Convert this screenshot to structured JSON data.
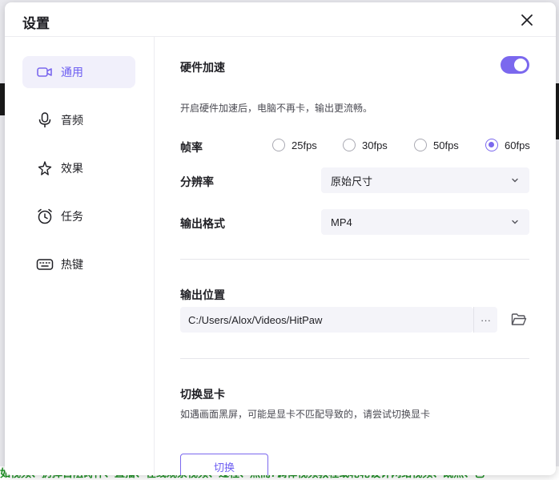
{
  "dialog": {
    "title": "设置"
  },
  "sidebar": {
    "items": [
      {
        "label": "通用",
        "icon": "video-camera-icon",
        "active": true
      },
      {
        "label": "音频",
        "icon": "microphone-icon",
        "active": false
      },
      {
        "label": "效果",
        "icon": "sparkle-icon",
        "active": false
      },
      {
        "label": "任务",
        "icon": "alarm-clock-icon",
        "active": false
      },
      {
        "label": "热键",
        "icon": "keyboard-icon",
        "active": false
      }
    ]
  },
  "general": {
    "hw_accel": {
      "title": "硬件加速",
      "enabled": true,
      "description": "开启硬件加速后，电脑不再卡，输出更流畅。"
    },
    "framerate": {
      "title": "帧率",
      "options": [
        "25fps",
        "30fps",
        "50fps",
        "60fps"
      ],
      "selected": "60fps"
    },
    "resolution": {
      "title": "分辨率",
      "value": "原始尺寸"
    },
    "format": {
      "title": "输出格式",
      "value": "MP4"
    },
    "output": {
      "title": "输出位置",
      "path": "C:/Users/Alox/Videos/HitPaw",
      "more_label": "···"
    },
    "gpu": {
      "title": "切换显卡",
      "description": "如遇画面黑屏，可能是显卡不匹配导致的，请尝试切换显卡",
      "button_label": "切换"
    }
  },
  "background": {
    "bottom_text": "如视频、扔掉首阻碍件、直播、在线观察视频、过程、然而7调律视频教程或轮轮设计网络视频、既然、已"
  },
  "colors": {
    "accent": "#7b68ee",
    "active_bg": "#f1f0fb",
    "field_bg": "#f4f4f9"
  }
}
